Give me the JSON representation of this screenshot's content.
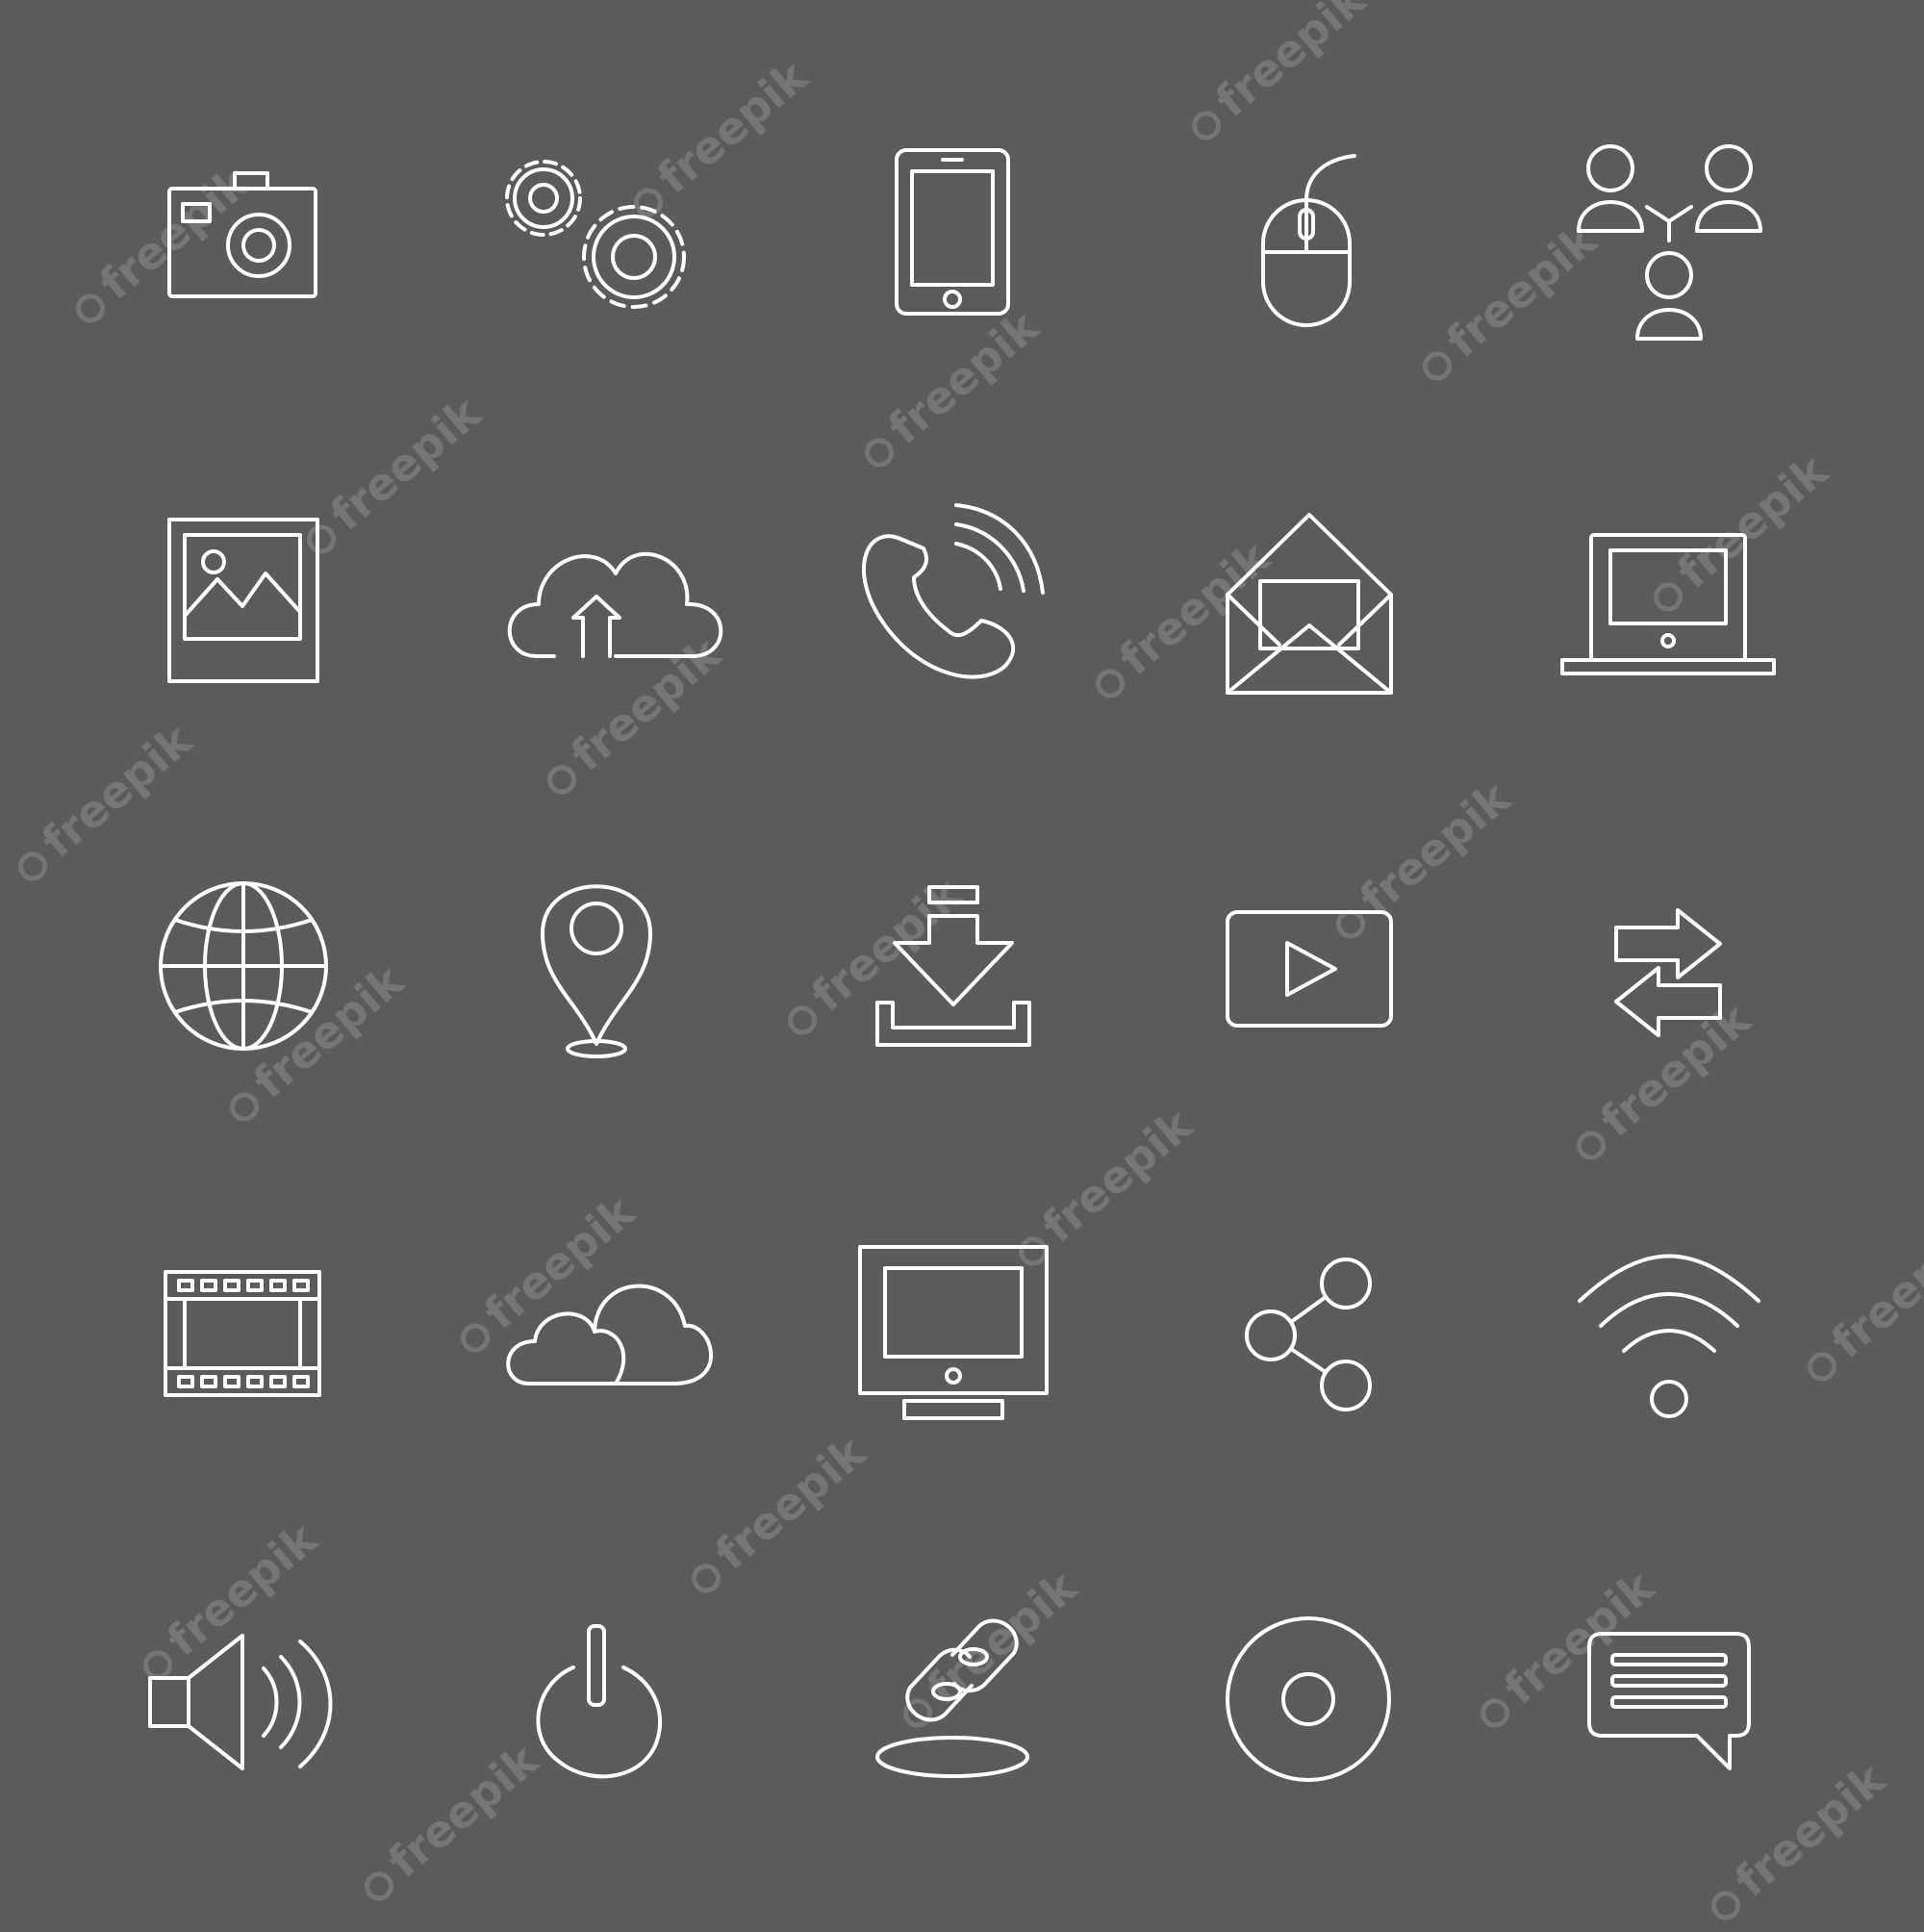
{
  "background_color": "#5a5b5d",
  "icon_color": "#ffffff",
  "watermark_text": "freepik",
  "icons": [
    "camera-icon",
    "gears-icon",
    "smartphone-icon",
    "mouse-icon",
    "network-users-icon",
    "photo-icon",
    "cloud-upload-icon",
    "phone-call-icon",
    "open-envelope-icon",
    "laptop-icon",
    "globe-icon",
    "location-pin-icon",
    "download-icon",
    "video-play-icon",
    "transfer-arrows-icon",
    "film-strip-icon",
    "clouds-icon",
    "monitor-icon",
    "share-icon",
    "wifi-icon",
    "speaker-icon",
    "power-icon",
    "link-icon",
    "disc-icon",
    "chat-bubble-icon"
  ]
}
